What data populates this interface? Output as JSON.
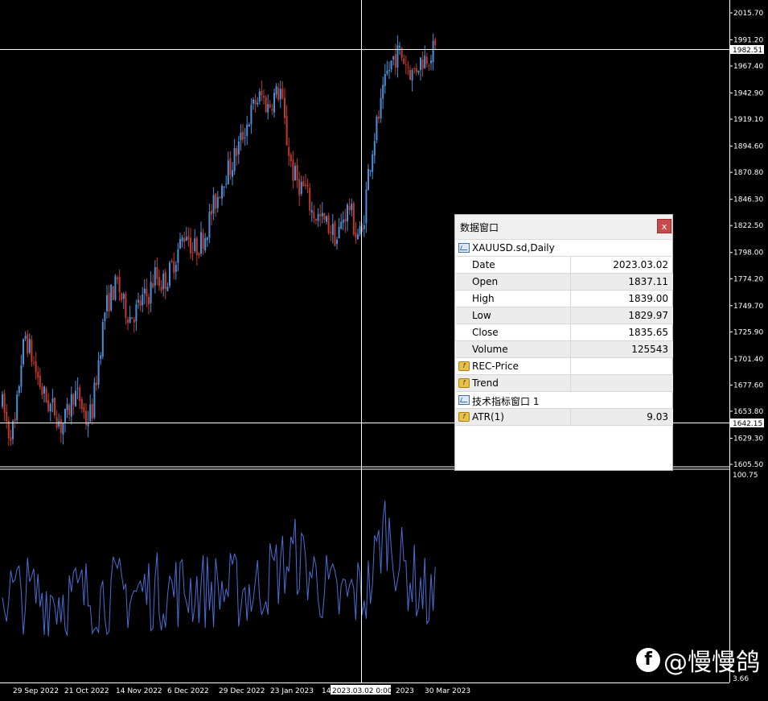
{
  "symbol_window": {
    "title": "数据窗口",
    "close_label": "x",
    "symbol_header": "XAUUSD.sd,Daily",
    "rows": [
      {
        "label": "Date",
        "value": "2023.03.02"
      },
      {
        "label": "Open",
        "value": "1837.11"
      },
      {
        "label": "High",
        "value": "1839.00"
      },
      {
        "label": "Low",
        "value": "1829.97"
      },
      {
        "label": "Close",
        "value": "1835.65"
      },
      {
        "label": "Volume",
        "value": "125543"
      }
    ],
    "indicators": [
      {
        "label": "REC-Price",
        "value": ""
      },
      {
        "label": "Trend",
        "value": ""
      }
    ],
    "subwindow_header": "技术指标窗口 1",
    "sub_indicators": [
      {
        "label": "ATR(1)",
        "value": "9.03"
      }
    ]
  },
  "price_axis": {
    "labels": [
      "2015.70",
      "1991.20",
      "1967.40",
      "1942.90",
      "1919.10",
      "1894.60",
      "1870.80",
      "1846.30",
      "1822.50",
      "1798.00",
      "1774.20",
      "1749.70",
      "1725.90",
      "1701.40",
      "1677.60",
      "1653.80",
      "1629.30",
      "1605.50"
    ],
    "values": [
      2015.7,
      1991.2,
      1967.4,
      1942.9,
      1919.1,
      1894.6,
      1870.8,
      1846.3,
      1822.5,
      1798.0,
      1774.2,
      1749.7,
      1725.9,
      1701.4,
      1677.6,
      1653.8,
      1629.3,
      1605.5
    ],
    "current_price_tag": "1982.51",
    "crosshair_price_tag": "1642.15"
  },
  "indicator_axis": {
    "top_label": "100.75",
    "bottom_label": "3.66"
  },
  "time_axis": {
    "labels": [
      "29 Sep 2022",
      "21 Oct 2022",
      "14 Nov 2022",
      "6 Dec 2022",
      "29 Dec 2022",
      "23 Jan 2023",
      "14",
      "2023",
      "30 Mar 2023"
    ],
    "crosshair_date_tag": "2023.03.02 0:00"
  },
  "colors": {
    "bull": "#4a90d9",
    "bear": "#c0392b",
    "atr_line": "#4a6fd6",
    "grid": "#ffffff"
  },
  "watermark": {
    "logo": "f",
    "text": "@慢慢鸽"
  },
  "chart_data": {
    "type": "candlestick",
    "symbol": "XAUUSD.sd",
    "timeframe": "Daily",
    "ylim": [
      1605.5,
      2015.7
    ],
    "path_anchors": [
      [
        0,
        1660
      ],
      [
        3,
        1635
      ],
      [
        6,
        1640
      ],
      [
        9,
        1700
      ],
      [
        11,
        1722
      ],
      [
        13,
        1710
      ],
      [
        16,
        1690
      ],
      [
        19,
        1672
      ],
      [
        22,
        1660
      ],
      [
        25,
        1655
      ],
      [
        28,
        1640
      ],
      [
        31,
        1650
      ],
      [
        34,
        1670
      ],
      [
        37,
        1665
      ],
      [
        40,
        1645
      ],
      [
        43,
        1655
      ],
      [
        46,
        1700
      ],
      [
        49,
        1745
      ],
      [
        52,
        1760
      ],
      [
        55,
        1770
      ],
      [
        58,
        1750
      ],
      [
        61,
        1740
      ],
      [
        64,
        1745
      ],
      [
        67,
        1755
      ],
      [
        70,
        1760
      ],
      [
        73,
        1778
      ],
      [
        76,
        1770
      ],
      [
        79,
        1775
      ],
      [
        82,
        1790
      ],
      [
        85,
        1805
      ],
      [
        88,
        1818
      ],
      [
        91,
        1800
      ],
      [
        94,
        1805
      ],
      [
        97,
        1815
      ],
      [
        100,
        1835
      ],
      [
        103,
        1850
      ],
      [
        106,
        1868
      ],
      [
        109,
        1875
      ],
      [
        112,
        1890
      ],
      [
        115,
        1905
      ],
      [
        118,
        1920
      ],
      [
        121,
        1935
      ],
      [
        124,
        1940
      ],
      [
        127,
        1930
      ],
      [
        130,
        1940
      ],
      [
        133,
        1945
      ],
      [
        136,
        1900
      ],
      [
        139,
        1870
      ],
      [
        142,
        1860
      ],
      [
        145,
        1855
      ],
      [
        148,
        1835
      ],
      [
        151,
        1830
      ],
      [
        154,
        1825
      ],
      [
        157,
        1820
      ],
      [
        160,
        1810
      ],
      [
        163,
        1830
      ],
      [
        166,
        1840
      ],
      [
        169,
        1815
      ],
      [
        172,
        1815
      ],
      [
        175,
        1870
      ],
      [
        178,
        1905
      ],
      [
        181,
        1930
      ],
      [
        184,
        1960
      ],
      [
        187,
        1975
      ],
      [
        190,
        1980
      ],
      [
        193,
        1970
      ],
      [
        196,
        1960
      ],
      [
        199,
        1970
      ],
      [
        202,
        1975
      ],
      [
        205,
        1980
      ],
      [
        207,
        1982
      ]
    ],
    "atr_anchors": [
      [
        0,
        44
      ],
      [
        30,
        42
      ],
      [
        60,
        44
      ],
      [
        90,
        46
      ],
      [
        120,
        45
      ],
      [
        140,
        62
      ],
      [
        160,
        40
      ],
      [
        175,
        46
      ],
      [
        183,
        76
      ],
      [
        190,
        58
      ],
      [
        200,
        46
      ],
      [
        207,
        38
      ]
    ]
  }
}
